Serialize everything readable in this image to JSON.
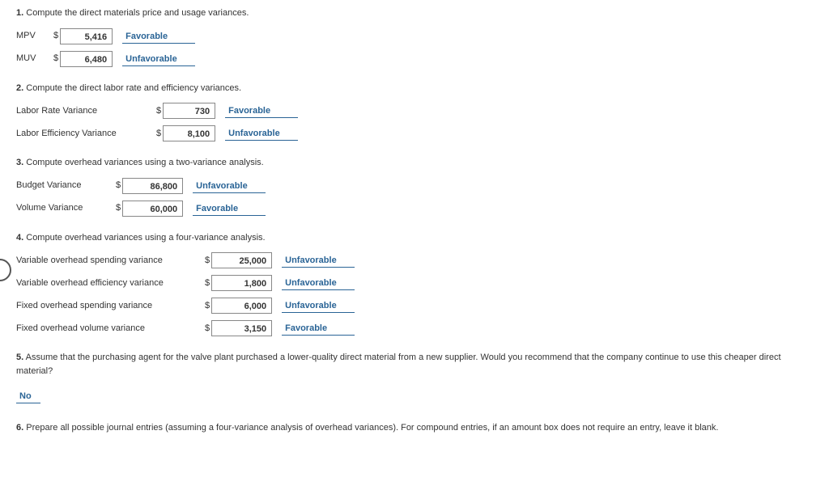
{
  "questions": {
    "q1": {
      "number": "1.",
      "text": "Compute the direct materials price and usage variances.",
      "rows": [
        {
          "label": "MPV",
          "currency": "$",
          "value": "5,416",
          "verdict": "Favorable"
        },
        {
          "label": "MUV",
          "currency": "$",
          "value": "6,480",
          "verdict": "Unfavorable"
        }
      ]
    },
    "q2": {
      "number": "2.",
      "text": "Compute the direct labor rate and efficiency variances.",
      "rows": [
        {
          "label": "Labor Rate Variance",
          "currency": "$",
          "value": "730",
          "verdict": "Favorable"
        },
        {
          "label": "Labor Efficiency Variance",
          "currency": "$",
          "value": "8,100",
          "verdict": "Unfavorable"
        }
      ]
    },
    "q3": {
      "number": "3.",
      "text": "Compute overhead variances using a two-variance analysis.",
      "rows": [
        {
          "label": "Budget Variance",
          "currency": "$",
          "value": "86,800",
          "verdict": "Unfavorable"
        },
        {
          "label": "Volume Variance",
          "currency": "$",
          "value": "60,000",
          "verdict": "Favorable"
        }
      ]
    },
    "q4": {
      "number": "4.",
      "text": "Compute overhead variances using a four-variance analysis.",
      "rows": [
        {
          "label": "Variable overhead spending variance",
          "currency": "$",
          "value": "25,000",
          "verdict": "Unfavorable"
        },
        {
          "label": "Variable overhead efficiency variance",
          "currency": "$",
          "value": "1,800",
          "verdict": "Unfavorable"
        },
        {
          "label": "Fixed overhead spending variance",
          "currency": "$",
          "value": "6,000",
          "verdict": "Unfavorable"
        },
        {
          "label": "Fixed overhead volume variance",
          "currency": "$",
          "value": "3,150",
          "verdict": "Favorable"
        }
      ]
    },
    "q5": {
      "number": "5.",
      "text": "Assume that the purchasing agent for the valve plant purchased a lower-quality direct material from a new supplier. Would you recommend that the company continue to use this cheaper direct material?",
      "answer": "No"
    },
    "q6": {
      "number": "6.",
      "text": "Prepare all possible journal entries (assuming a four-variance analysis of overhead variances). For compound entries, if an amount box does not require an entry, leave it blank."
    }
  }
}
